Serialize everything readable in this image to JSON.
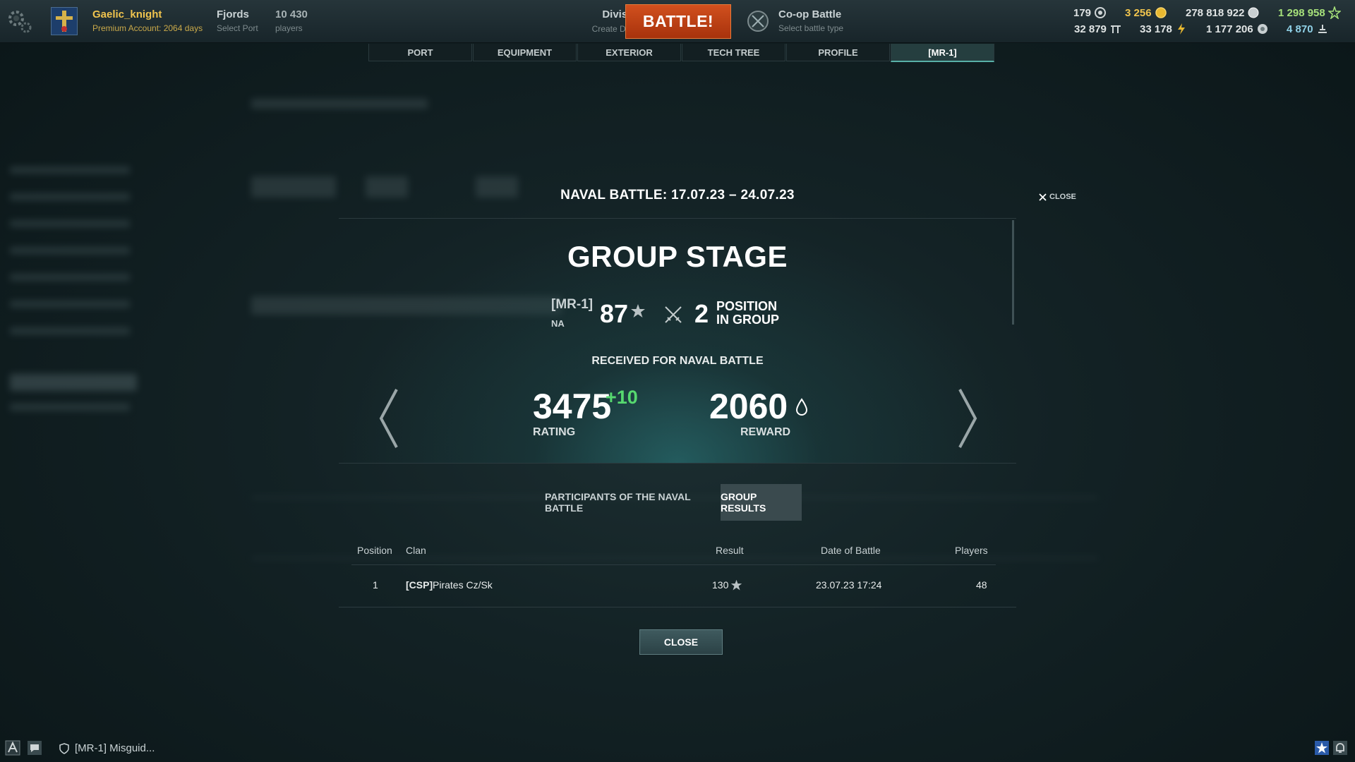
{
  "topbar": {
    "user_name": "Gaelic_knight",
    "premium_text": "Premium Account: 2064 days",
    "port_name": "Fjords",
    "port_sub": "Select Port",
    "players_count": "10 430",
    "players_label": "players",
    "divisions_title": "Divisions",
    "divisions_sub": "Create Division",
    "battle_label": "BATTLE!",
    "coop_title": "Co-op Battle",
    "coop_sub": "Select battle type",
    "currencies": {
      "doubloons_clan": "179",
      "doubloons": "3 256",
      "credits": "278 818 922",
      "free_xp": "1 298 958",
      "coal": "32 879",
      "steel": "33 178",
      "research_points": "1 177 206",
      "elite_xp": "4 870"
    }
  },
  "nav": {
    "tabs": [
      "PORT",
      "EQUIPMENT",
      "EXTERIOR",
      "TECH TREE",
      "PROFILE",
      "[MR-1]"
    ],
    "active_index": 5
  },
  "modal": {
    "title": "NAVAL BATTLE: 17.07.23 – 24.07.23",
    "close_top": "CLOSE",
    "stage_title": "GROUP STAGE",
    "clan_tag": "[MR-1]",
    "clan_region": "NA",
    "clan_rating": "87",
    "position_number": "2",
    "position_label_1": "POSITION",
    "position_label_2": "IN GROUP",
    "received_label": "RECEIVED FOR NAVAL BATTLE",
    "rating_value": "3475",
    "rating_delta": "+10",
    "rating_label": "RATING",
    "reward_value": "2060",
    "reward_label": "REWARD",
    "subtabs": [
      "PARTICIPANTS OF THE NAVAL BATTLE",
      "GROUP RESULTS"
    ],
    "table": {
      "headers": [
        "Position",
        "Clan",
        "Result",
        "Date of Battle",
        "Players"
      ],
      "rows": [
        {
          "position": "1",
          "clan_tag": "[CSP]",
          "clan_name": "Pirates Cz/Sk",
          "result": "130",
          "date": "23.07.23 17:24",
          "players": "48"
        }
      ]
    },
    "close_button": "CLOSE"
  },
  "bottom": {
    "clan_chat": "[MR-1] Misguid..."
  },
  "colors": {
    "battle_button": "#c4441a",
    "username": "#f0c44e",
    "rating_delta": "#56d86f",
    "free_xp": "#a6e07a",
    "elite_xp": "#8fd0e6"
  },
  "icons": [
    "gear-icon",
    "doubloon-icon",
    "coin-icon",
    "silver-icon",
    "star-icon",
    "coal-icon",
    "steel-icon",
    "research-icon",
    "elite-xp-icon",
    "swords-icon",
    "drop-icon",
    "chevron-left-icon",
    "chevron-right-icon",
    "close-icon",
    "chat-icon",
    "shield-icon",
    "bell-icon"
  ]
}
